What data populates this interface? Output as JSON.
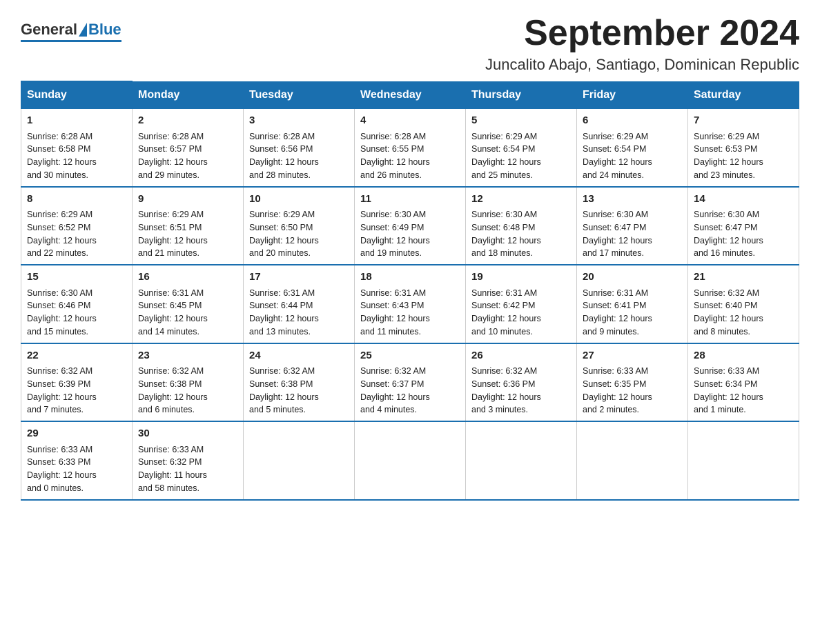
{
  "header": {
    "logo_general": "General",
    "logo_blue": "Blue",
    "month_title": "September 2024",
    "location": "Juncalito Abajo, Santiago, Dominican Republic"
  },
  "days_of_week": [
    "Sunday",
    "Monday",
    "Tuesday",
    "Wednesday",
    "Thursday",
    "Friday",
    "Saturday"
  ],
  "weeks": [
    [
      {
        "day": "1",
        "sunrise": "6:28 AM",
        "sunset": "6:58 PM",
        "daylight": "12 hours and 30 minutes."
      },
      {
        "day": "2",
        "sunrise": "6:28 AM",
        "sunset": "6:57 PM",
        "daylight": "12 hours and 29 minutes."
      },
      {
        "day": "3",
        "sunrise": "6:28 AM",
        "sunset": "6:56 PM",
        "daylight": "12 hours and 28 minutes."
      },
      {
        "day": "4",
        "sunrise": "6:28 AM",
        "sunset": "6:55 PM",
        "daylight": "12 hours and 26 minutes."
      },
      {
        "day": "5",
        "sunrise": "6:29 AM",
        "sunset": "6:54 PM",
        "daylight": "12 hours and 25 minutes."
      },
      {
        "day": "6",
        "sunrise": "6:29 AM",
        "sunset": "6:54 PM",
        "daylight": "12 hours and 24 minutes."
      },
      {
        "day": "7",
        "sunrise": "6:29 AM",
        "sunset": "6:53 PM",
        "daylight": "12 hours and 23 minutes."
      }
    ],
    [
      {
        "day": "8",
        "sunrise": "6:29 AM",
        "sunset": "6:52 PM",
        "daylight": "12 hours and 22 minutes."
      },
      {
        "day": "9",
        "sunrise": "6:29 AM",
        "sunset": "6:51 PM",
        "daylight": "12 hours and 21 minutes."
      },
      {
        "day": "10",
        "sunrise": "6:29 AM",
        "sunset": "6:50 PM",
        "daylight": "12 hours and 20 minutes."
      },
      {
        "day": "11",
        "sunrise": "6:30 AM",
        "sunset": "6:49 PM",
        "daylight": "12 hours and 19 minutes."
      },
      {
        "day": "12",
        "sunrise": "6:30 AM",
        "sunset": "6:48 PM",
        "daylight": "12 hours and 18 minutes."
      },
      {
        "day": "13",
        "sunrise": "6:30 AM",
        "sunset": "6:47 PM",
        "daylight": "12 hours and 17 minutes."
      },
      {
        "day": "14",
        "sunrise": "6:30 AM",
        "sunset": "6:47 PM",
        "daylight": "12 hours and 16 minutes."
      }
    ],
    [
      {
        "day": "15",
        "sunrise": "6:30 AM",
        "sunset": "6:46 PM",
        "daylight": "12 hours and 15 minutes."
      },
      {
        "day": "16",
        "sunrise": "6:31 AM",
        "sunset": "6:45 PM",
        "daylight": "12 hours and 14 minutes."
      },
      {
        "day": "17",
        "sunrise": "6:31 AM",
        "sunset": "6:44 PM",
        "daylight": "12 hours and 13 minutes."
      },
      {
        "day": "18",
        "sunrise": "6:31 AM",
        "sunset": "6:43 PM",
        "daylight": "12 hours and 11 minutes."
      },
      {
        "day": "19",
        "sunrise": "6:31 AM",
        "sunset": "6:42 PM",
        "daylight": "12 hours and 10 minutes."
      },
      {
        "day": "20",
        "sunrise": "6:31 AM",
        "sunset": "6:41 PM",
        "daylight": "12 hours and 9 minutes."
      },
      {
        "day": "21",
        "sunrise": "6:32 AM",
        "sunset": "6:40 PM",
        "daylight": "12 hours and 8 minutes."
      }
    ],
    [
      {
        "day": "22",
        "sunrise": "6:32 AM",
        "sunset": "6:39 PM",
        "daylight": "12 hours and 7 minutes."
      },
      {
        "day": "23",
        "sunrise": "6:32 AM",
        "sunset": "6:38 PM",
        "daylight": "12 hours and 6 minutes."
      },
      {
        "day": "24",
        "sunrise": "6:32 AM",
        "sunset": "6:38 PM",
        "daylight": "12 hours and 5 minutes."
      },
      {
        "day": "25",
        "sunrise": "6:32 AM",
        "sunset": "6:37 PM",
        "daylight": "12 hours and 4 minutes."
      },
      {
        "day": "26",
        "sunrise": "6:32 AM",
        "sunset": "6:36 PM",
        "daylight": "12 hours and 3 minutes."
      },
      {
        "day": "27",
        "sunrise": "6:33 AM",
        "sunset": "6:35 PM",
        "daylight": "12 hours and 2 minutes."
      },
      {
        "day": "28",
        "sunrise": "6:33 AM",
        "sunset": "6:34 PM",
        "daylight": "12 hours and 1 minute."
      }
    ],
    [
      {
        "day": "29",
        "sunrise": "6:33 AM",
        "sunset": "6:33 PM",
        "daylight": "12 hours and 0 minutes."
      },
      {
        "day": "30",
        "sunrise": "6:33 AM",
        "sunset": "6:32 PM",
        "daylight": "11 hours and 58 minutes."
      },
      null,
      null,
      null,
      null,
      null
    ]
  ]
}
